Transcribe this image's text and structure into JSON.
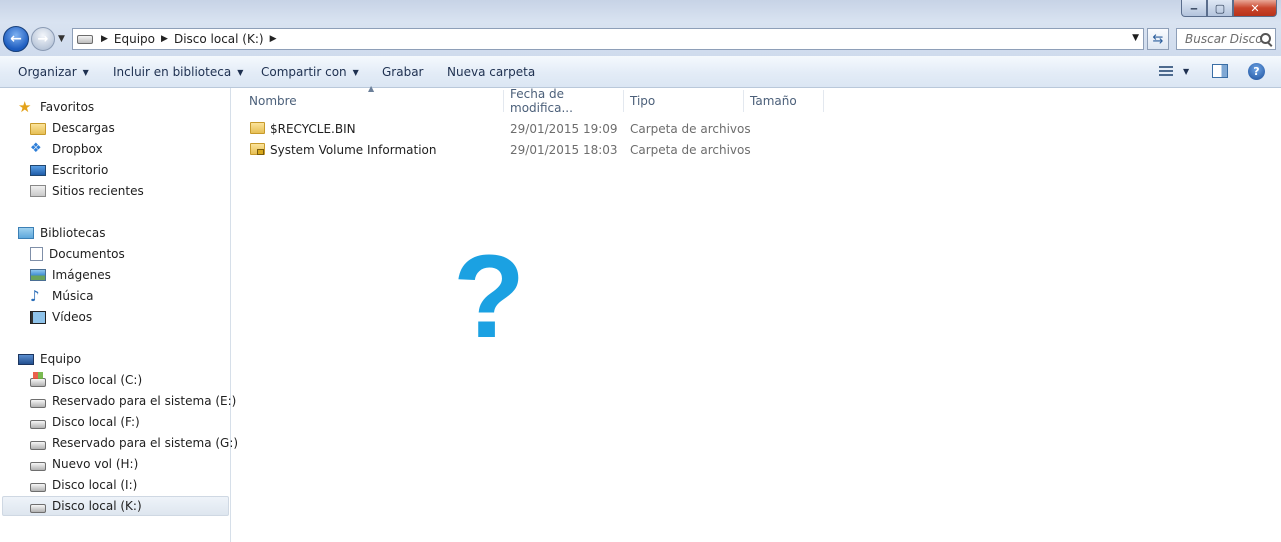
{
  "window": {
    "controls": {
      "minimize": "‒",
      "maximize": "▢",
      "close": "✕"
    }
  },
  "address_bar": {
    "breadcrumbs": [
      "Equipo",
      "Disco local (K:)"
    ],
    "search_placeholder": "Buscar Disco..."
  },
  "command_bar": {
    "organize": "Organizar",
    "include_library": "Incluir en biblioteca",
    "share_with": "Compartir con",
    "burn": "Grabar",
    "new_folder": "Nueva carpeta"
  },
  "nav_pane": {
    "favorites": {
      "label": "Favoritos",
      "items": [
        "Descargas",
        "Dropbox",
        "Escritorio",
        "Sitios recientes"
      ]
    },
    "libraries": {
      "label": "Bibliotecas",
      "items": [
        "Documentos",
        "Imágenes",
        "Música",
        "Vídeos"
      ]
    },
    "computer": {
      "label": "Equipo",
      "items": [
        "Disco local (C:)",
        "Reservado para el sistema (E:)",
        "Disco local (F:)",
        "Reservado para el sistema (G:)",
        "Nuevo vol (H:)",
        "Disco local (I:)",
        "Disco local (K:)"
      ],
      "selected": "Disco local (K:)"
    }
  },
  "file_list": {
    "columns": [
      "Nombre",
      "Fecha de modifica...",
      "Tipo",
      "Tamaño"
    ],
    "rows": [
      {
        "name": "$RECYCLE.BIN",
        "modified": "29/01/2015 19:09",
        "type": "Carpeta de archivos",
        "size": ""
      },
      {
        "name": "System Volume Information",
        "modified": "29/01/2015 18:03",
        "type": "Carpeta de archivos",
        "size": ""
      }
    ]
  },
  "overlay": {
    "symbol": "?",
    "color": "#1ba1e2"
  }
}
